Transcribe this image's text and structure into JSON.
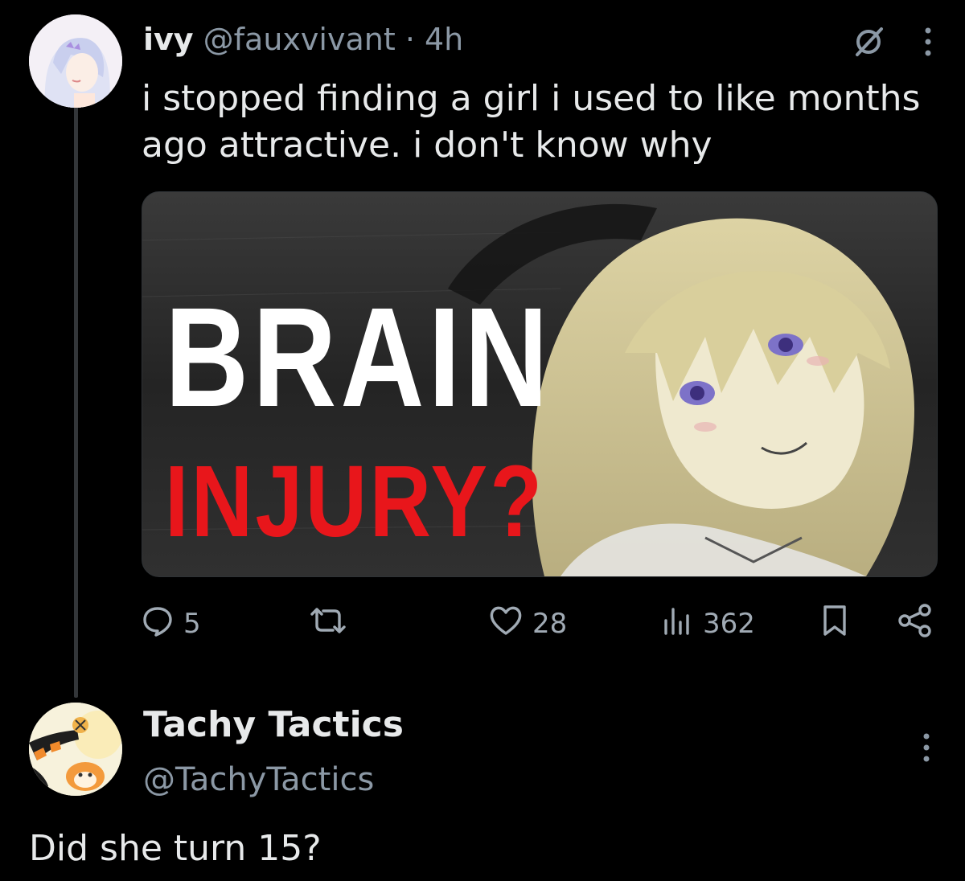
{
  "tweet": {
    "author_name": "ivy",
    "author_handle": "@fauxvivant",
    "separator": "·",
    "time": "4h",
    "text": "i stopped finding a girl i used to like months ago attractive. i don't know why",
    "media": {
      "title_line1": "BRAIN",
      "title_line2": "INJURY?"
    },
    "actions": {
      "replies": "5",
      "reposts": "",
      "likes": "28",
      "views": "362"
    }
  },
  "reply": {
    "author_name": "Tachy Tactics",
    "author_handle": "@TachyTactics",
    "text": "Did she turn 15?"
  },
  "icons": {
    "grok": "grok-icon",
    "more": "more-vertical-icon",
    "reply": "reply-icon",
    "repost": "repost-icon",
    "like": "heart-icon",
    "views": "views-icon",
    "bookmark": "bookmark-icon",
    "share": "share-icon"
  },
  "colors": {
    "background": "#000000",
    "text": "#e7e9ea",
    "muted": "#8b98a5",
    "media_red": "#e8161b",
    "media_white": "#ffffff"
  }
}
